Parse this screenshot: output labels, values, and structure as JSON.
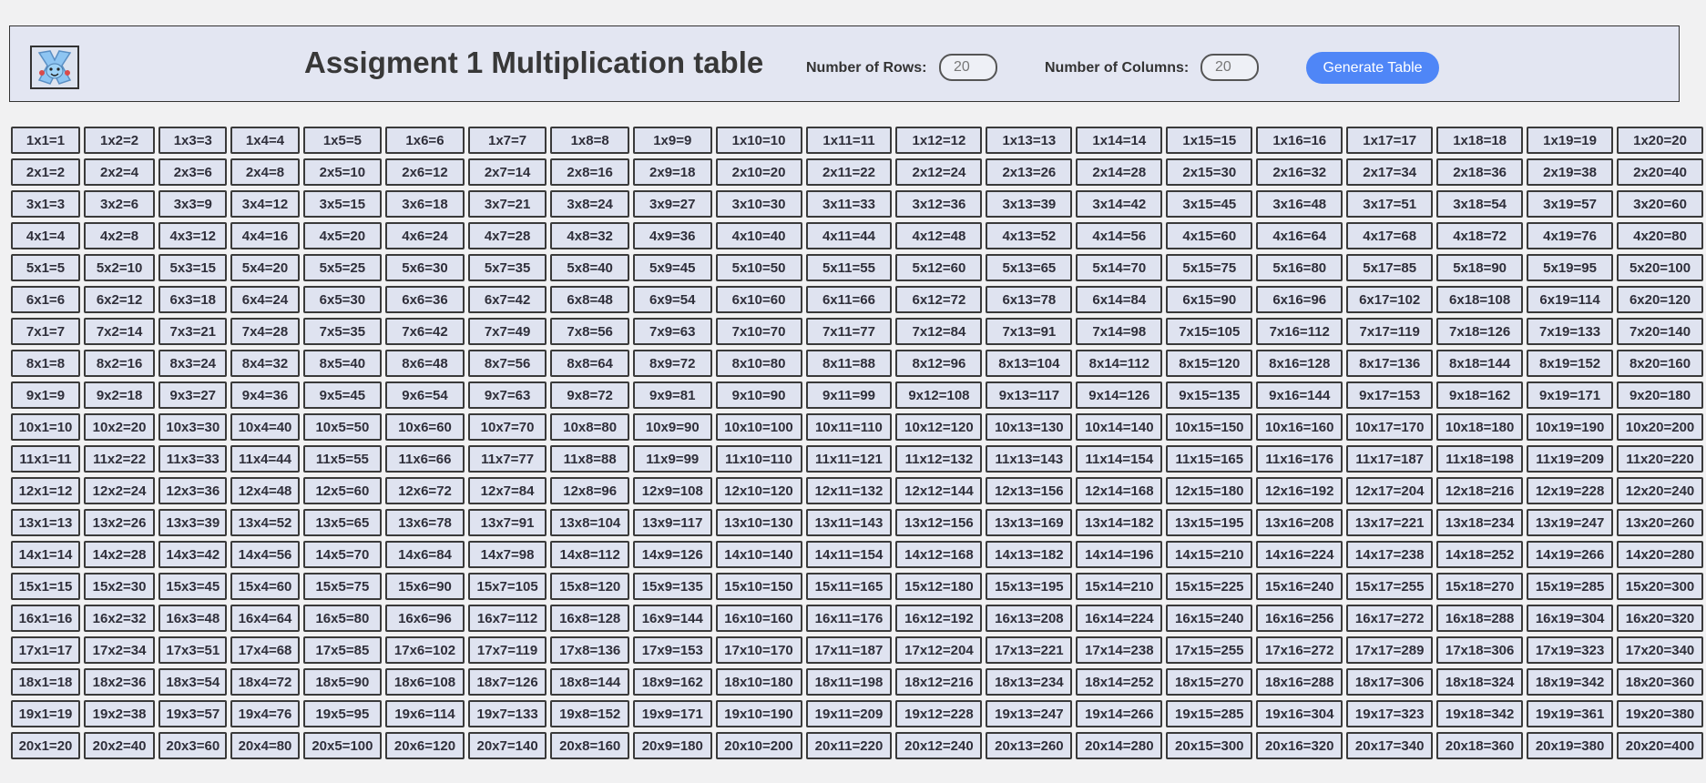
{
  "header": {
    "logo_icon": "pokemon-logo-icon",
    "title": "Assigment 1 Multiplication table",
    "rows_label": "Number of Rows:",
    "rows_value": "20",
    "cols_label": "Number of Columns:",
    "cols_value": "20",
    "generate_label": "Generate Table"
  },
  "table": {
    "rows": 20,
    "columns": 20,
    "cells": [
      [
        "1x1=1",
        "1x2=2",
        "1x3=3",
        "1x4=4",
        "1x5=5",
        "1x6=6",
        "1x7=7",
        "1x8=8",
        "1x9=9",
        "1x10=10",
        "1x11=11",
        "1x12=12",
        "1x13=13",
        "1x14=14",
        "1x15=15",
        "1x16=16",
        "1x17=17",
        "1x18=18",
        "1x19=19",
        "1x20=20"
      ],
      [
        "2x1=2",
        "2x2=4",
        "2x3=6",
        "2x4=8",
        "2x5=10",
        "2x6=12",
        "2x7=14",
        "2x8=16",
        "2x9=18",
        "2x10=20",
        "2x11=22",
        "2x12=24",
        "2x13=26",
        "2x14=28",
        "2x15=30",
        "2x16=32",
        "2x17=34",
        "2x18=36",
        "2x19=38",
        "2x20=40"
      ],
      [
        "3x1=3",
        "3x2=6",
        "3x3=9",
        "3x4=12",
        "3x5=15",
        "3x6=18",
        "3x7=21",
        "3x8=24",
        "3x9=27",
        "3x10=30",
        "3x11=33",
        "3x12=36",
        "3x13=39",
        "3x14=42",
        "3x15=45",
        "3x16=48",
        "3x17=51",
        "3x18=54",
        "3x19=57",
        "3x20=60"
      ],
      [
        "4x1=4",
        "4x2=8",
        "4x3=12",
        "4x4=16",
        "4x5=20",
        "4x6=24",
        "4x7=28",
        "4x8=32",
        "4x9=36",
        "4x10=40",
        "4x11=44",
        "4x12=48",
        "4x13=52",
        "4x14=56",
        "4x15=60",
        "4x16=64",
        "4x17=68",
        "4x18=72",
        "4x19=76",
        "4x20=80"
      ],
      [
        "5x1=5",
        "5x2=10",
        "5x3=15",
        "5x4=20",
        "5x5=25",
        "5x6=30",
        "5x7=35",
        "5x8=40",
        "5x9=45",
        "5x10=50",
        "5x11=55",
        "5x12=60",
        "5x13=65",
        "5x14=70",
        "5x15=75",
        "5x16=80",
        "5x17=85",
        "5x18=90",
        "5x19=95",
        "5x20=100"
      ],
      [
        "6x1=6",
        "6x2=12",
        "6x3=18",
        "6x4=24",
        "6x5=30",
        "6x6=36",
        "6x7=42",
        "6x8=48",
        "6x9=54",
        "6x10=60",
        "6x11=66",
        "6x12=72",
        "6x13=78",
        "6x14=84",
        "6x15=90",
        "6x16=96",
        "6x17=102",
        "6x18=108",
        "6x19=114",
        "6x20=120"
      ],
      [
        "7x1=7",
        "7x2=14",
        "7x3=21",
        "7x4=28",
        "7x5=35",
        "7x6=42",
        "7x7=49",
        "7x8=56",
        "7x9=63",
        "7x10=70",
        "7x11=77",
        "7x12=84",
        "7x13=91",
        "7x14=98",
        "7x15=105",
        "7x16=112",
        "7x17=119",
        "7x18=126",
        "7x19=133",
        "7x20=140"
      ],
      [
        "8x1=8",
        "8x2=16",
        "8x3=24",
        "8x4=32",
        "8x5=40",
        "8x6=48",
        "8x7=56",
        "8x8=64",
        "8x9=72",
        "8x10=80",
        "8x11=88",
        "8x12=96",
        "8x13=104",
        "8x14=112",
        "8x15=120",
        "8x16=128",
        "8x17=136",
        "8x18=144",
        "8x19=152",
        "8x20=160"
      ],
      [
        "9x1=9",
        "9x2=18",
        "9x3=27",
        "9x4=36",
        "9x5=45",
        "9x6=54",
        "9x7=63",
        "9x8=72",
        "9x9=81",
        "9x10=90",
        "9x11=99",
        "9x12=108",
        "9x13=117",
        "9x14=126",
        "9x15=135",
        "9x16=144",
        "9x17=153",
        "9x18=162",
        "9x19=171",
        "9x20=180"
      ],
      [
        "10x1=10",
        "10x2=20",
        "10x3=30",
        "10x4=40",
        "10x5=50",
        "10x6=60",
        "10x7=70",
        "10x8=80",
        "10x9=90",
        "10x10=100",
        "10x11=110",
        "10x12=120",
        "10x13=130",
        "10x14=140",
        "10x15=150",
        "10x16=160",
        "10x17=170",
        "10x18=180",
        "10x19=190",
        "10x20=200"
      ],
      [
        "11x1=11",
        "11x2=22",
        "11x3=33",
        "11x4=44",
        "11x5=55",
        "11x6=66",
        "11x7=77",
        "11x8=88",
        "11x9=99",
        "11x10=110",
        "11x11=121",
        "11x12=132",
        "11x13=143",
        "11x14=154",
        "11x15=165",
        "11x16=176",
        "11x17=187",
        "11x18=198",
        "11x19=209",
        "11x20=220"
      ],
      [
        "12x1=12",
        "12x2=24",
        "12x3=36",
        "12x4=48",
        "12x5=60",
        "12x6=72",
        "12x7=84",
        "12x8=96",
        "12x9=108",
        "12x10=120",
        "12x11=132",
        "12x12=144",
        "12x13=156",
        "12x14=168",
        "12x15=180",
        "12x16=192",
        "12x17=204",
        "12x18=216",
        "12x19=228",
        "12x20=240"
      ],
      [
        "13x1=13",
        "13x2=26",
        "13x3=39",
        "13x4=52",
        "13x5=65",
        "13x6=78",
        "13x7=91",
        "13x8=104",
        "13x9=117",
        "13x10=130",
        "13x11=143",
        "13x12=156",
        "13x13=169",
        "13x14=182",
        "13x15=195",
        "13x16=208",
        "13x17=221",
        "13x18=234",
        "13x19=247",
        "13x20=260"
      ],
      [
        "14x1=14",
        "14x2=28",
        "14x3=42",
        "14x4=56",
        "14x5=70",
        "14x6=84",
        "14x7=98",
        "14x8=112",
        "14x9=126",
        "14x10=140",
        "14x11=154",
        "14x12=168",
        "14x13=182",
        "14x14=196",
        "14x15=210",
        "14x16=224",
        "14x17=238",
        "14x18=252",
        "14x19=266",
        "14x20=280"
      ],
      [
        "15x1=15",
        "15x2=30",
        "15x3=45",
        "15x4=60",
        "15x5=75",
        "15x6=90",
        "15x7=105",
        "15x8=120",
        "15x9=135",
        "15x10=150",
        "15x11=165",
        "15x12=180",
        "15x13=195",
        "15x14=210",
        "15x15=225",
        "15x16=240",
        "15x17=255",
        "15x18=270",
        "15x19=285",
        "15x20=300"
      ],
      [
        "16x1=16",
        "16x2=32",
        "16x3=48",
        "16x4=64",
        "16x5=80",
        "16x6=96",
        "16x7=112",
        "16x8=128",
        "16x9=144",
        "16x10=160",
        "16x11=176",
        "16x12=192",
        "16x13=208",
        "16x14=224",
        "16x15=240",
        "16x16=256",
        "16x17=272",
        "16x18=288",
        "16x19=304",
        "16x20=320"
      ],
      [
        "17x1=17",
        "17x2=34",
        "17x3=51",
        "17x4=68",
        "17x5=85",
        "17x6=102",
        "17x7=119",
        "17x8=136",
        "17x9=153",
        "17x10=170",
        "17x11=187",
        "17x12=204",
        "17x13=221",
        "17x14=238",
        "17x15=255",
        "17x16=272",
        "17x17=289",
        "17x18=306",
        "17x19=323",
        "17x20=340"
      ],
      [
        "18x1=18",
        "18x2=36",
        "18x3=54",
        "18x4=72",
        "18x5=90",
        "18x6=108",
        "18x7=126",
        "18x8=144",
        "18x9=162",
        "18x10=180",
        "18x11=198",
        "18x12=216",
        "18x13=234",
        "18x14=252",
        "18x15=270",
        "18x16=288",
        "18x17=306",
        "18x18=324",
        "18x19=342",
        "18x20=360"
      ],
      [
        "19x1=19",
        "19x2=38",
        "19x3=57",
        "19x4=76",
        "19x5=95",
        "19x6=114",
        "19x7=133",
        "19x8=152",
        "19x9=171",
        "19x10=190",
        "19x11=209",
        "19x12=228",
        "19x13=247",
        "19x14=266",
        "19x15=285",
        "19x16=304",
        "19x17=323",
        "19x18=342",
        "19x19=361",
        "19x20=380"
      ],
      [
        "20x1=20",
        "20x2=40",
        "20x3=60",
        "20x4=80",
        "20x5=100",
        "20x6=120",
        "20x7=140",
        "20x8=160",
        "20x9=180",
        "20x10=200",
        "20x11=220",
        "20x12=240",
        "20x13=260",
        "20x14=280",
        "20x15=300",
        "20x16=320",
        "20x17=340",
        "20x18=360",
        "20x19=380",
        "20x20=400"
      ]
    ]
  }
}
